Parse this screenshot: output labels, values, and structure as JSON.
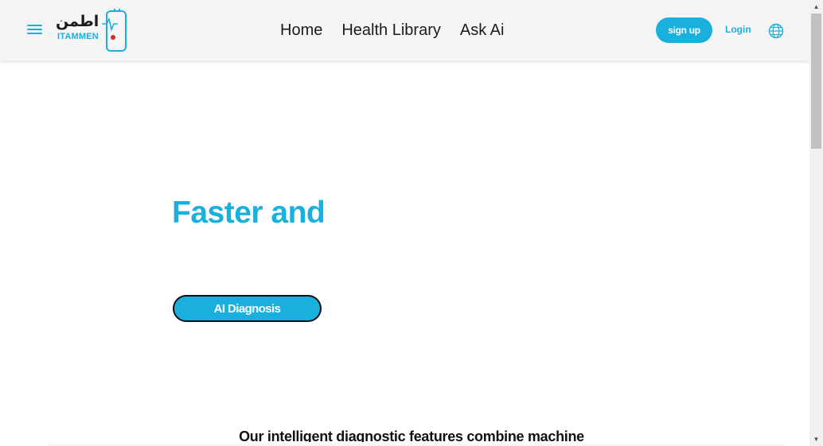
{
  "header": {
    "logo": {
      "arabic_text": "اطمن",
      "latin_text": "ITAMMEN"
    },
    "nav": [
      {
        "label": "Home"
      },
      {
        "label": "Health Library"
      },
      {
        "label": "Ask Ai"
      }
    ],
    "signup_label": "sign up",
    "login_label": "Login",
    "menu_icon": "hamburger-icon",
    "language_icon": "globe-icon"
  },
  "hero": {
    "title": "Faster and",
    "cta_label": "AI Diagnosis"
  },
  "description": {
    "text": "Our intelligent diagnostic features combine machine"
  },
  "colors": {
    "accent": "#1ab0de",
    "header_bg": "#f5f5f5",
    "text": "#1b1b1b"
  }
}
